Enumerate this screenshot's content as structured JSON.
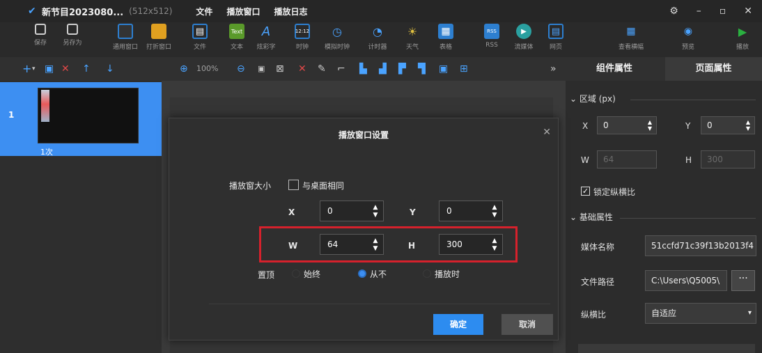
{
  "titlebar": {
    "program_name": "新节目2023080...",
    "program_size": "(512x512)",
    "menus": [
      "文件",
      "播放窗口",
      "播放日志"
    ]
  },
  "toolbar": {
    "buttons": [
      {
        "label": "保存",
        "icon": "save-icon",
        "color": "#9a9a9a"
      },
      {
        "label": "另存为",
        "icon": "save-as-icon",
        "color": "#9a9a9a"
      },
      {
        "label": "通用窗口",
        "icon": "window-icon",
        "color": "#2d2d2d"
      },
      {
        "label": "打折窗口",
        "icon": "split-window-icon",
        "color": "#e0a020"
      },
      {
        "label": "文件",
        "icon": "folder-icon",
        "color": "#2d7fd0"
      },
      {
        "label": "文本",
        "icon": "text-icon",
        "color": "#5a9a2a"
      },
      {
        "label": "炫彩字",
        "icon": "colorful-text-icon",
        "color": "#2d7fd0"
      },
      {
        "label": "时钟",
        "icon": "clock-icon",
        "color": "#2d7fd0"
      },
      {
        "label": "模拟时钟",
        "icon": "analog-clock-icon",
        "color": "#2d7fd0"
      },
      {
        "label": "计时器",
        "icon": "timer-icon",
        "color": "#2d7fd0"
      },
      {
        "label": "天气",
        "icon": "weather-icon",
        "color": "#d0a020"
      },
      {
        "label": "表格",
        "icon": "table-icon",
        "color": "#2d7fd0"
      },
      {
        "label": "RSS",
        "icon": "rss-icon",
        "color": "#2d7fd0"
      },
      {
        "label": "流媒体",
        "icon": "stream-icon",
        "color": "#2aa0a0"
      },
      {
        "label": "网页",
        "icon": "webpage-icon",
        "color": "#2d7fd0"
      },
      {
        "label": "查看横幅",
        "icon": "banner-icon",
        "color": "#2d7fd0"
      },
      {
        "label": "预览",
        "icon": "preview-icon",
        "color": "#2d7fd0"
      },
      {
        "label": "播放",
        "icon": "play-icon",
        "color": "#2ab040"
      }
    ]
  },
  "toolbar2": {
    "zoom": "100%",
    "tabs": [
      "组件属性",
      "页面属性"
    ]
  },
  "pages": [
    {
      "number": "1",
      "play_count": "1次"
    }
  ],
  "dialog": {
    "title": "播放窗口设置",
    "size_label": "播放窗大小",
    "same_as_desktop": "与桌面相同",
    "x_label": "X",
    "x_value": "0",
    "y_label": "Y",
    "y_value": "0",
    "w_label": "W",
    "w_value": "64",
    "h_label": "H",
    "h_value": "300",
    "ontop_label": "置顶",
    "ontop_options": [
      "始终",
      "从不",
      "播放时"
    ],
    "ontop_selected": "从不",
    "ok_label": "确定",
    "cancel_label": "取消"
  },
  "rightpanel": {
    "region_title": "区域 (px)",
    "x_label": "X",
    "x_value": "0",
    "y_label": "Y",
    "y_value": "0",
    "w_label": "W",
    "w_value": "64",
    "h_label": "H",
    "h_value": "300",
    "lock_ratio": "锁定纵横比",
    "basic_title": "基础属性",
    "media_name_label": "媒体名称",
    "media_name_value": "51ccfd71c39f13b2013f4",
    "file_path_label": "文件路径",
    "file_path_value": "C:\\Users\\Q5005\\",
    "aspect_label": "纵横比",
    "aspect_value": "自适应"
  }
}
